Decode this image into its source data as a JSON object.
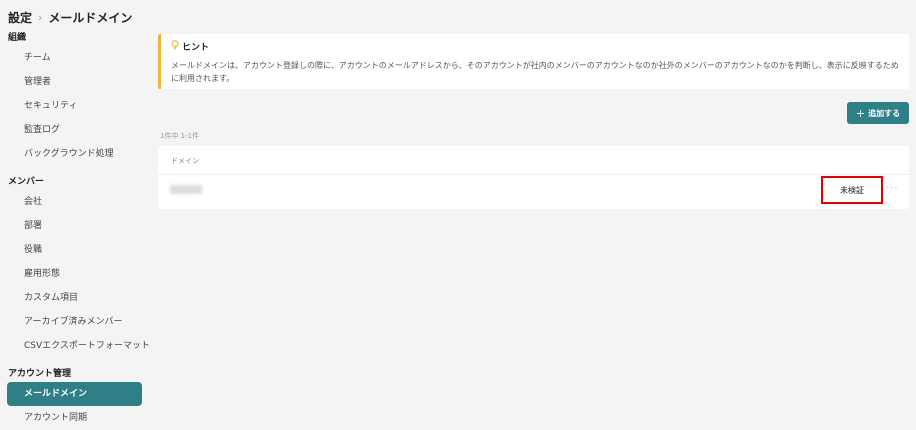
{
  "breadcrumb": {
    "root": "設定",
    "current": "メールドメイン"
  },
  "sidebar": {
    "groups": [
      {
        "title": "組織",
        "items": [
          "チーム",
          "管理者",
          "セキュリティ",
          "監査ログ",
          "バックグラウンド処理"
        ]
      },
      {
        "title": "メンバー",
        "items": [
          "会社",
          "部署",
          "役職",
          "雇用形態",
          "カスタム項目",
          "アーカイブ済みメンバー",
          "CSVエクスポートフォーマット"
        ]
      },
      {
        "title": "アカウント管理",
        "items": [
          "メールドメイン",
          "アカウント同期"
        ]
      }
    ],
    "active": "メールドメイン"
  },
  "hint": {
    "title": "ヒント",
    "text": "メールドメインは、アカウント登録しの際に、アカウントのメールアドレスから、そのアカウントが社内のメンバーのアカウントなのか社外のメンバーのアカウントなのかを判断し、表示に反映するために利用されます。"
  },
  "toolbar": {
    "add_label": "追加する"
  },
  "list": {
    "count_text": "1件中 1-1件",
    "columns": [
      "ドメイン"
    ],
    "rows": [
      {
        "status": "未検証"
      }
    ]
  },
  "colors": {
    "accent": "#2f7f86",
    "hint_border": "#f0b43c",
    "highlight": "#e00000"
  }
}
